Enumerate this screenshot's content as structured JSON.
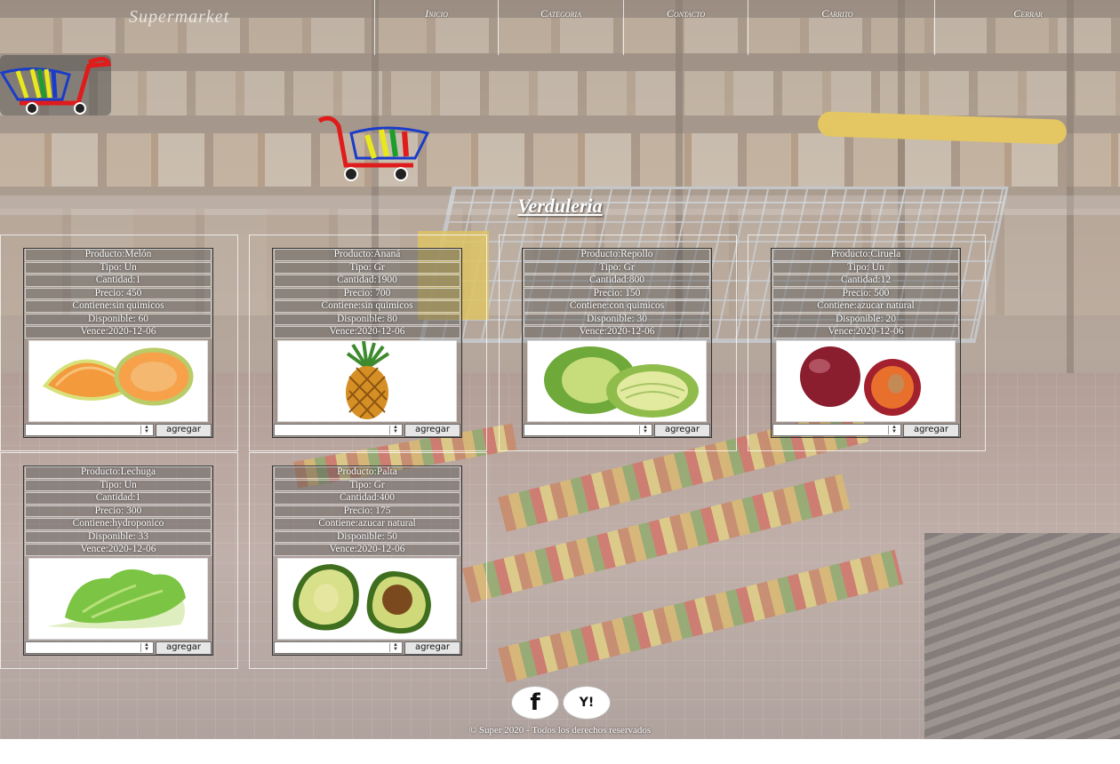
{
  "brand": "Supermarket",
  "nav": [
    {
      "label": "Inicio"
    },
    {
      "label": "Categoria"
    },
    {
      "label": "Contacto"
    },
    {
      "label": "Carrito"
    },
    {
      "label": "Cerrar"
    }
  ],
  "section_title": "Verduleria",
  "products": [
    {
      "producto": "Producto:Melón",
      "tipo": "Tipo: Un",
      "cantidad": "Cantidad:1",
      "precio": "Precio: 450",
      "contiene": "Contiene:sin quimicos",
      "disponible": "Disponible: 60",
      "vence": "Vence:2020-12-06",
      "image": "melon",
      "button": "agregar"
    },
    {
      "producto": "Producto:Ananá",
      "tipo": "Tipo: Gr",
      "cantidad": "Cantidad:1900",
      "precio": "Precio: 700",
      "contiene": "Contiene:sin quimicos",
      "disponible": "Disponible: 80",
      "vence": "Vence:2020-12-06",
      "image": "pineapple",
      "button": "agregar"
    },
    {
      "producto": "Producto:Repollo",
      "tipo": "Tipo: Gr",
      "cantidad": "Cantidad:800",
      "precio": "Precio: 150",
      "contiene": "Contiene:con quimicos",
      "disponible": "Disponible: 30",
      "vence": "Vence:2020-12-06",
      "image": "cabbage",
      "button": "agregar"
    },
    {
      "producto": "Producto:Ciruela",
      "tipo": "Tipo: Un",
      "cantidad": "Cantidad:12",
      "precio": "Precio: 500",
      "contiene": "Contiene:azucar natural",
      "disponible": "Disponible: 20",
      "vence": "Vence:2020-12-06",
      "image": "plum",
      "button": "agregar"
    },
    {
      "producto": "Producto:Lechuga",
      "tipo": "Tipo: Un",
      "cantidad": "Cantidad:1",
      "precio": "Precio: 300",
      "contiene": "Contiene:hydroponico",
      "disponible": "Disponible: 33",
      "vence": "Vence:2020-12-06",
      "image": "lettuce",
      "button": "agregar"
    },
    {
      "producto": "Producto:Palta",
      "tipo": "Tipo: Gr",
      "cantidad": "Cantidad:400",
      "precio": "Precio: 175",
      "contiene": "Contiene:azucar natural",
      "disponible": "Disponible: 50",
      "vence": "Vence:2020-12-06",
      "image": "avocado",
      "button": "agregar"
    }
  ],
  "social": [
    {
      "label": "f",
      "icon": "facebook-icon"
    },
    {
      "label": "Y!",
      "icon": "yahoo-icon"
    }
  ],
  "footer": {
    "copyright": "© Super 2020 - Todos los derechos reservados"
  },
  "colors": {
    "accent_yellow": "#f2c526",
    "cart_red": "#e01b1b",
    "nav_text": "#ffffff"
  }
}
